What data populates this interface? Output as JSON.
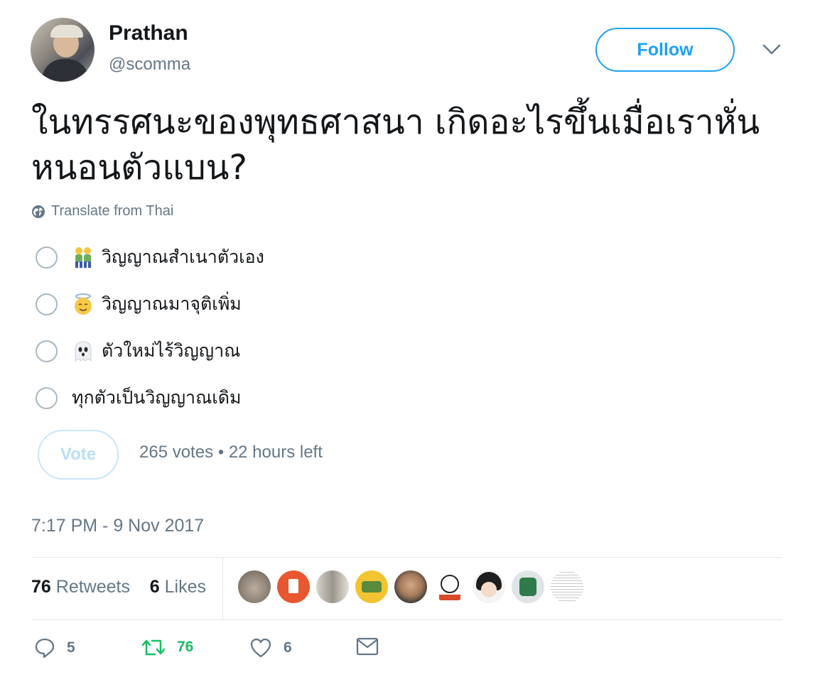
{
  "user": {
    "name": "Prathan",
    "handle": "@scomma"
  },
  "follow_label": "Follow",
  "tweet_text": "ในทรรศนะของพุทธศาสนา เกิดอะไรขึ้นเมื่อเราหั่นหนอนตัวแบน?",
  "translate_label": "Translate from Thai",
  "poll": {
    "options": [
      {
        "emoji": "two-men-emoji",
        "label": "วิญญาณสำเนาตัวเอง"
      },
      {
        "emoji": "angel-emoji",
        "label": "วิญญาณมาจุติเพิ่ม"
      },
      {
        "emoji": "ghost-emoji",
        "label": "ตัวใหม่ไร้วิญญาณ"
      },
      {
        "emoji": "",
        "label": "ทุกตัวเป็นวิญญาณเดิม"
      }
    ],
    "vote_label": "Vote",
    "meta": "265 votes • 22 hours left"
  },
  "timestamp": "7:17 PM - 9 Nov 2017",
  "stats": {
    "retweets_count": "76",
    "retweets_label": "Retweets",
    "likes_count": "6",
    "likes_label": "Likes"
  },
  "actions": {
    "replies": "5",
    "retweets": "76",
    "likes": "6"
  },
  "colors": {
    "accent": "#1da1f2",
    "retweet_green": "#17bf63",
    "muted": "#657786"
  }
}
